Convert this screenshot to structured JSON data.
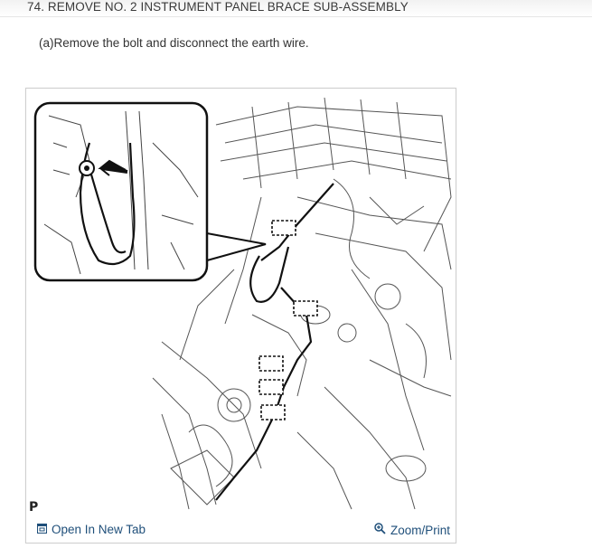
{
  "step": {
    "title": "74. REMOVE NO. 2 INSTRUMENT PANEL BRACE SUB-ASSEMBLY"
  },
  "instruction": {
    "text": "(a)Remove the bolt and disconnect the earth wire."
  },
  "figure": {
    "corner_label": "P",
    "open_tab_label": "Open In New Tab",
    "zoom_print_label": "Zoom/Print",
    "icons": [
      "open-new-tab-icon",
      "zoom-magnifier-icon"
    ],
    "link_color": "#1f4f7a"
  }
}
